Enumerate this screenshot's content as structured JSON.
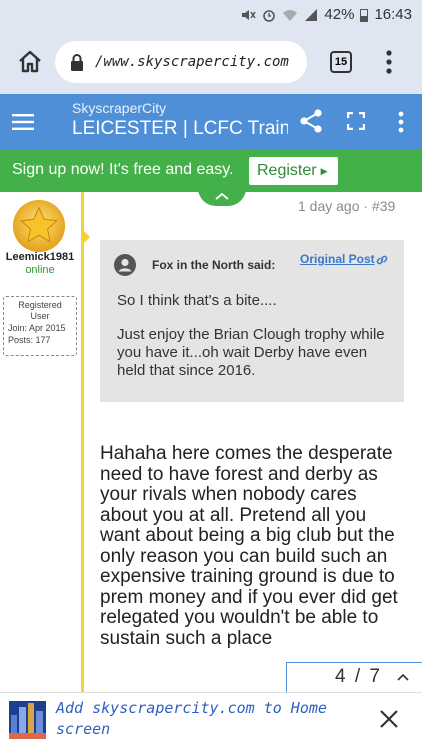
{
  "status": {
    "battery": "42%",
    "time": "16:43"
  },
  "browser": {
    "url": "/www.skyscrapercity.com",
    "tab_count": "15"
  },
  "site": {
    "name": "SkyscraperCity",
    "thread_title": "LEICESTER | LCFC Training Ground"
  },
  "signup": {
    "text": "Sign up now! It's free and easy.",
    "register_label": "Register"
  },
  "post": {
    "date": "1 day ago · #39",
    "user": {
      "name": "Leemick1981",
      "status": "online",
      "role_line1": "Registered",
      "role_line2": "User",
      "join": "Join: Apr 2015",
      "posts": "Posts: 177"
    },
    "quote": {
      "author": "Fox in the North said:",
      "original_post_label": "Original Post",
      "paragraph1": "So I think that's a bite....",
      "paragraph2": "Just enjoy the Brian Clough trophy while you have it...oh wait Derby have even held that since 2016."
    },
    "body": "Hahaha here comes the desperate need to have forest and derby as your rivals when nobody cares about you at all. Pretend all you want about being a big club but the only reason you can build such an expensive training ground is due to prem money and if you ever did get relegated you wouldn't be able to sustain such a place"
  },
  "pager": {
    "text": "4 / 7"
  },
  "homebar": {
    "text": "Add skyscrapercity.com to Home screen"
  },
  "colors": {
    "site_bar": "#4f8fd8",
    "signup_bar": "#43b049",
    "quote_bg": "#e4e4e4",
    "timeline": "#f5d233"
  }
}
